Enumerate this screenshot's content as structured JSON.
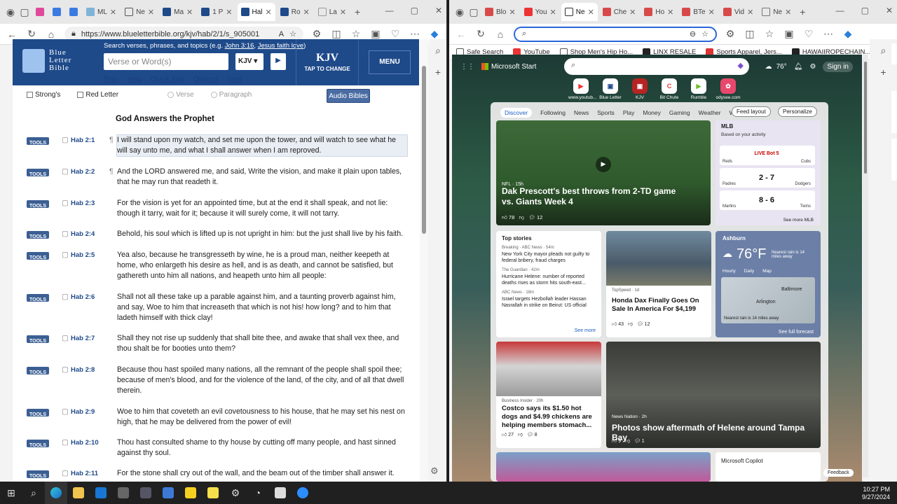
{
  "left": {
    "tabs": [
      "ML",
      "Ne",
      "Ma",
      "1 P",
      "Hal",
      "Ro",
      "La"
    ],
    "active_tab": 4,
    "url": "https://www.blueletterbible.org/kjv/hab/2/1/s_905001",
    "site": {
      "logo_line1": "Blue",
      "logo_line2": "Letter",
      "logo_line3": "Bible",
      "search_label": "Search verses, phrases, and topics (e.g.",
      "search_example1": "John 3:16",
      "search_example2": "Jesus faith love",
      "search_placeholder": "Verse or Word(s)",
      "version": "KJV",
      "version_big": "KJV",
      "tap_to_change": "TAP TO CHANGE",
      "menu": "MENU",
      "nav": [
        "Prev",
        "Help",
        "Quick Nav",
        "Options",
        "Next"
      ],
      "opt_strongs": "Strong's",
      "opt_red_letter": "Red Letter",
      "opt_verse": "Verse",
      "opt_paragraph": "Paragraph",
      "audio_bibles": "Audio Bibles",
      "chapter_title": "God Answers the Prophet",
      "tools_label": "TOOLS",
      "verses": [
        {
          "ref": "Hab 2:1",
          "para": true,
          "text": "I will stand upon my watch, and set me upon the tower, and will watch to see what he will say unto me, and what I shall answer when I am reproved."
        },
        {
          "ref": "Hab 2:2",
          "para": true,
          "text": "And the LORD answered me, and said, Write the vision, and make it plain upon tables, that he may run that readeth it."
        },
        {
          "ref": "Hab 2:3",
          "para": false,
          "text": "For the vision is yet for an appointed time, but at the end it shall speak, and not lie: though it tarry, wait for it; because it will surely come, it will not tarry."
        },
        {
          "ref": "Hab 2:4",
          "para": false,
          "text": "Behold, his soul which is lifted up is not upright in him: but the just shall live by his faith."
        },
        {
          "ref": "Hab 2:5",
          "para": false,
          "text": "Yea also, because he transgresseth by wine, he is a proud man, neither keepeth at home, who enlargeth his desire as hell, and is as death, and cannot be satisfied, but gathereth unto him all nations, and heapeth unto him all people:"
        },
        {
          "ref": "Hab 2:6",
          "para": false,
          "text": "Shall not all these take up a parable against him, and a taunting proverb against him, and say, Woe to him that increaseth that which is not his! how long? and to him that ladeth himself with thick clay!"
        },
        {
          "ref": "Hab 2:7",
          "para": false,
          "text": "Shall they not rise up suddenly that shall bite thee, and awake that shall vex thee, and thou shalt be for booties unto them?"
        },
        {
          "ref": "Hab 2:8",
          "para": false,
          "text": "Because thou hast spoiled many nations, all the remnant of the people shall spoil thee; because of men's blood, and for the violence of the land, of the city, and of all that dwell therein."
        },
        {
          "ref": "Hab 2:9",
          "para": false,
          "text": "Woe to him that coveteth an evil covetousness to his house, that he may set his nest on high, that he may be delivered from the power of evil!"
        },
        {
          "ref": "Hab 2:10",
          "para": false,
          "text": "Thou hast consulted shame to thy house by cutting off many people, and hast sinned against thy soul."
        },
        {
          "ref": "Hab 2:11",
          "para": false,
          "text": "For the stone shall cry out of the wall, and the beam out of the timber shall answer it."
        }
      ]
    }
  },
  "right": {
    "tabs": [
      "Blo",
      "You",
      "Ne",
      "Che",
      "Ho",
      "BTe",
      "Vid",
      "Ne"
    ],
    "active_tab": 2,
    "url": "",
    "bookmarks": [
      "Safe Search",
      "YouTube",
      "Shop Men's Hip Ho...",
      "LINX RESALE",
      "Sports Apparel, Jers...",
      "HAWAIIROPECHAIN..."
    ],
    "msn": {
      "brand": "Microsoft Start",
      "temp_header": "76°",
      "sign_in": "Sign in",
      "quick_links": [
        "www.youtub...",
        "Blue Letter",
        "KJV",
        "Bit Chute",
        "Rumble",
        "odysee.com"
      ],
      "feed_nav": [
        "Discover",
        "Following",
        "News",
        "Sports",
        "Play",
        "Money",
        "Gaming",
        "Weather",
        "Watch"
      ],
      "feed_layout": "Feed layout",
      "personalize": "Personalize",
      "hero": {
        "source": "NFL · 15h",
        "title": "Dak Prescott's best throws from 2-TD game vs. Giants Week 4",
        "likes": "78",
        "comments": "12"
      },
      "mlb": {
        "title": "MLB",
        "subtitle": "Based on your activity",
        "rows": [
          {
            "left": "Reds",
            "score": "LIVE Bot 5",
            "right": "Cubs"
          },
          {
            "left": "Padres",
            "score": "2 - 7",
            "right": "Dodgers"
          },
          {
            "left": "Marlins",
            "score": "8 - 6",
            "right": "Twins"
          }
        ],
        "see_more": "See more MLB"
      },
      "top_stories": {
        "title": "Top stories",
        "items": [
          {
            "src": "Breaking · ABC News · 54m",
            "text": "New York City mayor pleads not guilty to federal bribery, fraud charges"
          },
          {
            "src": "The Guardian · 42m",
            "text": "Hurricane Helene: number of reported deaths rises as storm hits south-east..."
          },
          {
            "src": "ABC News · 18m",
            "text": "Israel targets Hezbollah leader Hassan Nasrallah in strike on Beirut: US official"
          }
        ],
        "see_more": "See more"
      },
      "honda": {
        "src": "TopSpeed · 1d",
        "title": "Honda Dax Finally Goes On Sale In America For $4,199",
        "likes": "43",
        "comments": "12"
      },
      "weather": {
        "location": "Ashburn",
        "temp": "76°F",
        "note": "Nearest rain is 14 miles away",
        "tabs": [
          "Hourly",
          "Daily",
          "Map"
        ],
        "cities": [
          "Baltimore",
          "Arlington"
        ],
        "map_note": "Nearest rain is 14 miles away",
        "forecast": "See full forecast"
      },
      "costco": {
        "src": "Business Insider · 20h",
        "title": "Costco says its $1.50 hot dogs and $4.99 chickens are helping members stomach...",
        "likes": "27",
        "comments": "8"
      },
      "helene": {
        "src": "News Nation · 2h",
        "title": "Photos show aftermath of Helene around Tampa Bay",
        "likes": "9",
        "comments": "1"
      },
      "copilot": "Microsoft Copilot",
      "feedback": "Feedback"
    }
  },
  "taskbar": {
    "time": "10:27 PM",
    "date": "9/27/2024"
  }
}
